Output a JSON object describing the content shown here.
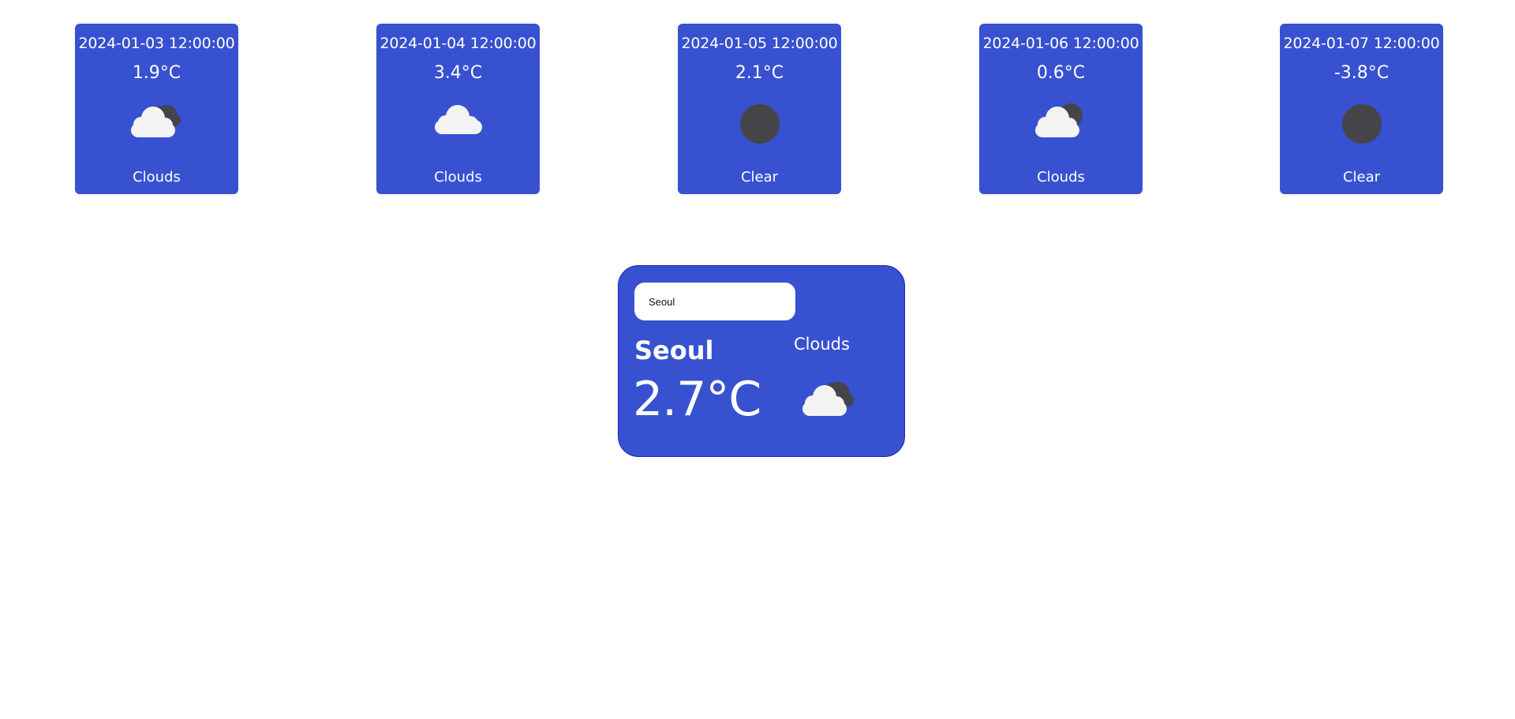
{
  "forecast": [
    {
      "date": "2024-01-03 12:00:00",
      "temp": "1.9°C",
      "description": "Clouds",
      "icon": "cloud-sun-icon"
    },
    {
      "date": "2024-01-04 12:00:00",
      "temp": "3.4°C",
      "description": "Clouds",
      "icon": "cloud-icon"
    },
    {
      "date": "2024-01-05 12:00:00",
      "temp": "2.1°C",
      "description": "Clear",
      "icon": "clear-icon"
    },
    {
      "date": "2024-01-06 12:00:00",
      "temp": "0.6°C",
      "description": "Clouds",
      "icon": "cloud-sun-icon"
    },
    {
      "date": "2024-01-07 12:00:00",
      "temp": "-3.8°C",
      "description": "Clear",
      "icon": "clear-icon"
    }
  ],
  "current": {
    "search_value": "Seoul",
    "city": "Seoul",
    "temp": "2.7°C",
    "description": "Clouds",
    "icon": "cloud-sun-icon"
  },
  "colors": {
    "card_bg": "#3751d0",
    "card_border": "#1a27b8",
    "cloud": "#f3f3f3",
    "dark_disc": "#454549"
  }
}
